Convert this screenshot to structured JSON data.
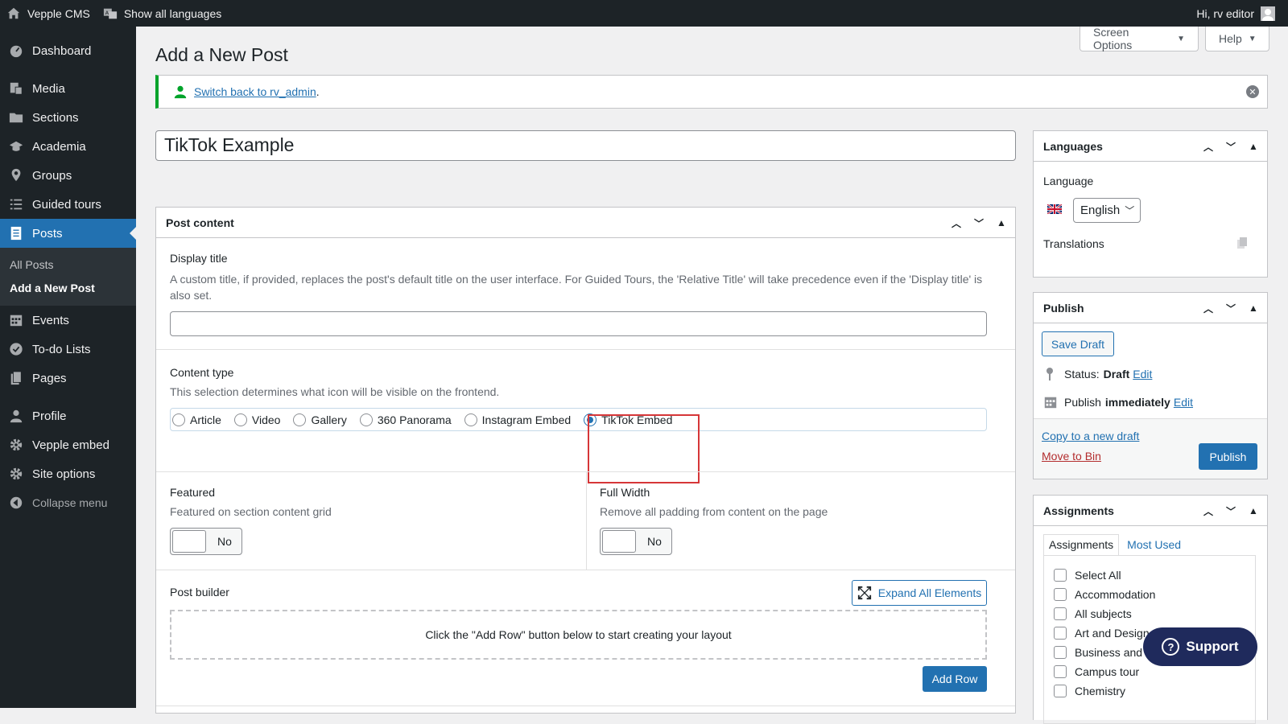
{
  "adminbar": {
    "site_name": "Vepple CMS",
    "languages": "Show all languages",
    "greeting": "Hi, rv editor"
  },
  "sidebar": {
    "items": [
      {
        "label": "Dashboard",
        "icon": "dashboard-icon"
      },
      {
        "label": "Media",
        "icon": "media-icon"
      },
      {
        "label": "Sections",
        "icon": "folder-icon"
      },
      {
        "label": "Academia",
        "icon": "graduation-cap-icon"
      },
      {
        "label": "Groups",
        "icon": "location-pin-icon"
      },
      {
        "label": "Guided tours",
        "icon": "list-icon"
      },
      {
        "label": "Posts",
        "icon": "post-icon"
      },
      {
        "label": "Events",
        "icon": "calendar-icon"
      },
      {
        "label": "To-do Lists",
        "icon": "check-circle-icon"
      },
      {
        "label": "Pages",
        "icon": "pages-icon"
      },
      {
        "label": "Profile",
        "icon": "user-icon"
      },
      {
        "label": "Vepple embed",
        "icon": "gear-icon"
      },
      {
        "label": "Site options",
        "icon": "gear-icon"
      }
    ],
    "submenu": [
      "All Posts",
      "Add a New Post"
    ],
    "collapse": "Collapse menu"
  },
  "screen_options": "Screen Options",
  "help": "Help",
  "page_title": "Add a New Post",
  "notice": {
    "link": "Switch back to rv_admin",
    "suffix": "."
  },
  "post_title": "TikTok Example",
  "post_content": {
    "title": "Post content",
    "display_title": {
      "label": "Display title",
      "desc": "A custom title, if provided, replaces the post's default title on the user interface. For Guided Tours, the 'Relative Title' will take precedence even if the 'Display title' is also set.",
      "value": ""
    },
    "content_type": {
      "label": "Content type",
      "desc": "This selection determines what icon will be visible on the frontend.",
      "options": [
        "Article",
        "Video",
        "Gallery",
        "360 Panorama",
        "Instagram Embed",
        "TikTok Embed"
      ],
      "selected": "TikTok Embed"
    },
    "featured": {
      "label": "Featured",
      "desc": "Featured on section content grid",
      "value": "No"
    },
    "full_width": {
      "label": "Full Width",
      "desc": "Remove all padding from content on the page",
      "value": "No"
    },
    "post_builder": {
      "label": "Post builder",
      "expand": "Expand All Elements",
      "empty": "Click the \"Add Row\" button below to start creating your layout",
      "add_row": "Add Row"
    }
  },
  "languages_box": {
    "title": "Languages",
    "language_label": "Language",
    "language_value": "English",
    "translations": "Translations"
  },
  "publish_box": {
    "title": "Publish",
    "save_draft": "Save Draft",
    "status_label": "Status:",
    "status_value": "Draft",
    "edit": "Edit",
    "publish_label": "Publish",
    "publish_value": "immediately",
    "copy": "Copy to a new draft",
    "bin": "Move to Bin",
    "publish_btn": "Publish"
  },
  "assignments_box": {
    "title": "Assignments",
    "tabs": [
      "Assignments",
      "Most Used"
    ],
    "items": [
      "Select All",
      "Accommodation",
      "All subjects",
      "Art and Design",
      "Business and Man",
      "Campus tour",
      "Chemistry"
    ]
  },
  "support": "Support",
  "colors": {
    "accent": "#2271b1",
    "highlight": "#d63638"
  }
}
